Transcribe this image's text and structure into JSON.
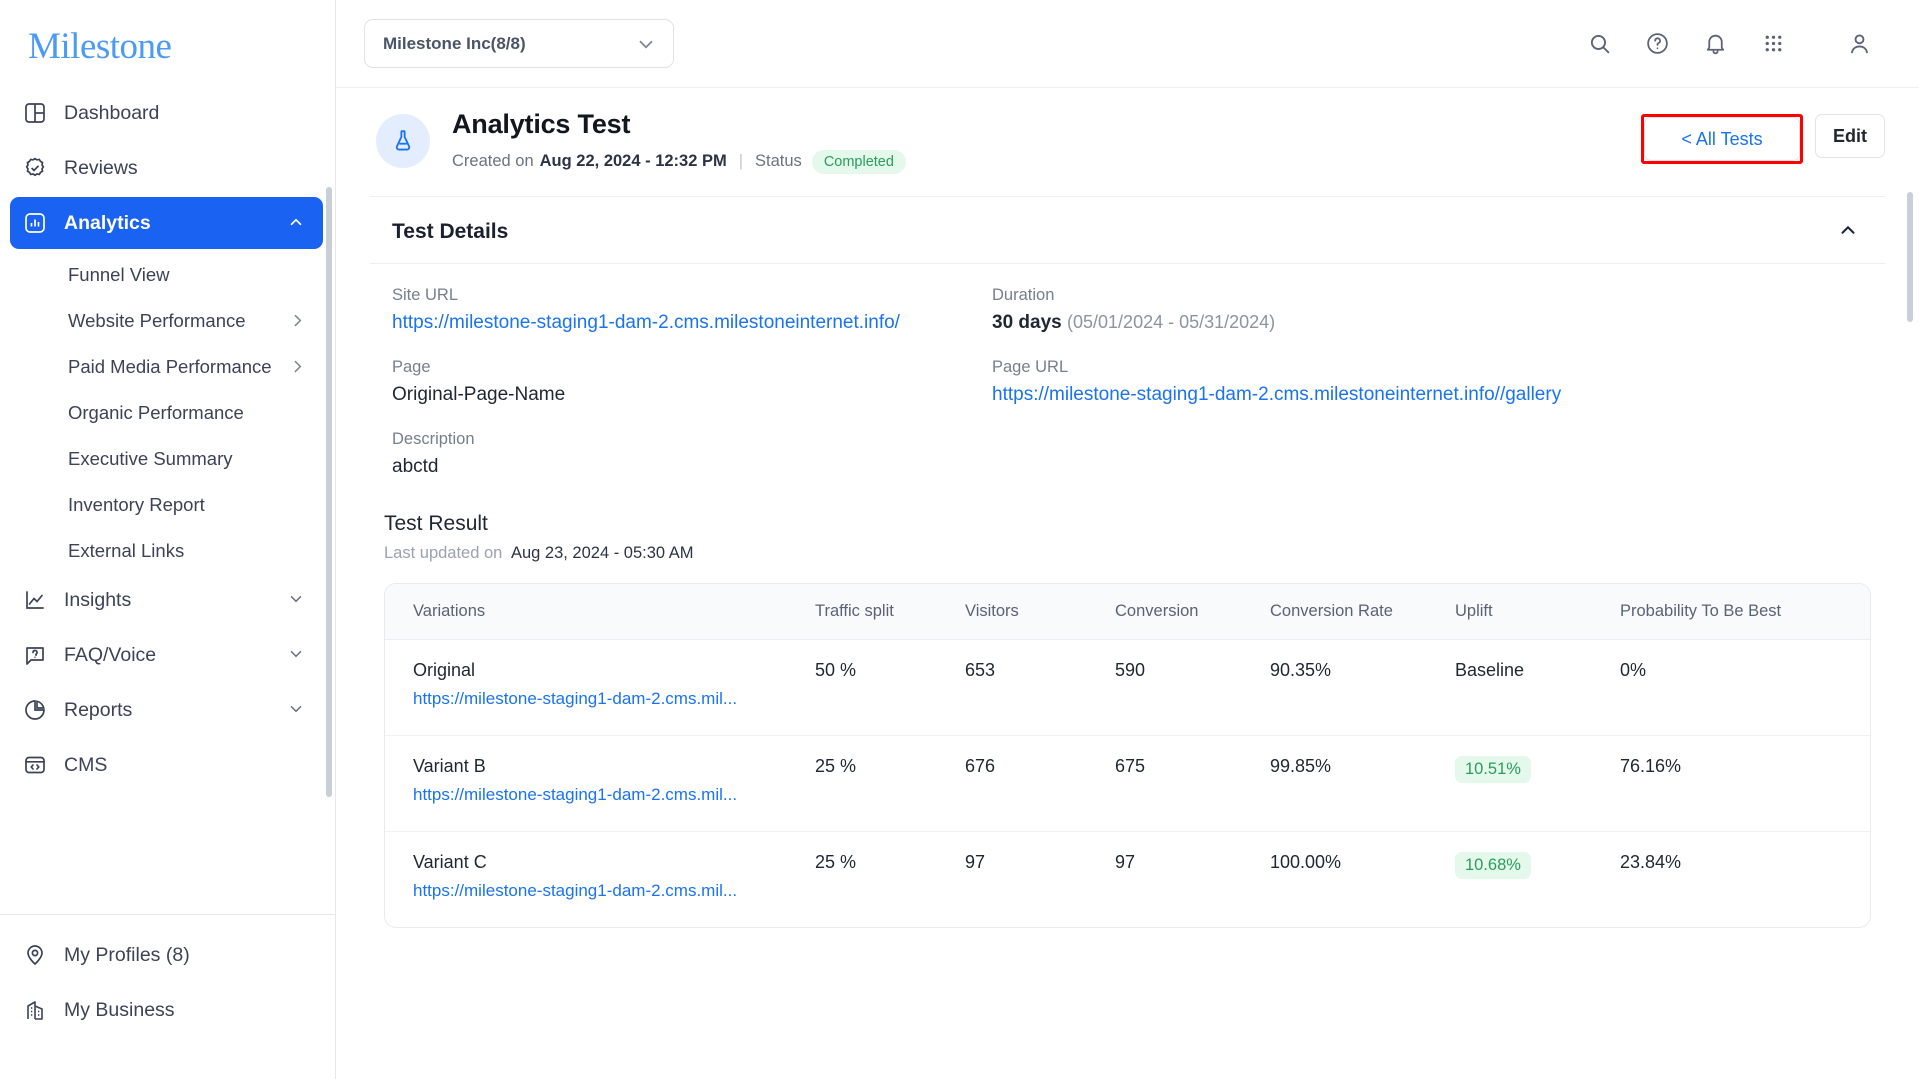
{
  "brand": {
    "logo_text": "Milestone",
    "logo_color": "#4b9bf5",
    "accent": "#1a62f2",
    "link_color": "#1a73ef",
    "success": "#2a9d5c",
    "highlight_border": "#ff0000"
  },
  "sidebar": {
    "items": [
      {
        "label": "Dashboard",
        "icon": "dashboard-icon",
        "type": "item"
      },
      {
        "label": "Reviews",
        "icon": "check-badge-icon",
        "type": "item"
      },
      {
        "label": "Analytics",
        "icon": "bar-chart-icon",
        "type": "item",
        "active": true,
        "chevron": "chevron-up-icon"
      },
      {
        "label": "Funnel View",
        "type": "sub"
      },
      {
        "label": "Website Performance",
        "type": "sub",
        "chevron": "chevron-right-icon"
      },
      {
        "label": "Paid Media Performance",
        "type": "sub",
        "chevron": "chevron-right-icon"
      },
      {
        "label": "Organic Performance",
        "type": "sub"
      },
      {
        "label": "Executive Summary",
        "type": "sub"
      },
      {
        "label": "Inventory Report",
        "type": "sub"
      },
      {
        "label": "External Links",
        "type": "sub"
      },
      {
        "label": "Insights",
        "icon": "trend-line-icon",
        "type": "item",
        "chevron": "chevron-down-icon"
      },
      {
        "label": "FAQ/Voice",
        "icon": "question-bubble-icon",
        "type": "item",
        "chevron": "chevron-down-icon"
      },
      {
        "label": "Reports",
        "icon": "pie-chart-icon",
        "type": "item",
        "chevron": "chevron-down-icon"
      },
      {
        "label": "CMS",
        "icon": "code-window-icon",
        "type": "item"
      }
    ],
    "bottom_items": [
      {
        "label": "My Profiles (8)",
        "icon": "location-pin-icon"
      },
      {
        "label": "My Business",
        "icon": "building-icon"
      }
    ]
  },
  "topbar": {
    "org_select": {
      "value": "Milestone Inc(8/8)",
      "chevron": "chevron-down-icon"
    },
    "icons": [
      {
        "name": "search-icon"
      },
      {
        "name": "help-circle-icon"
      },
      {
        "name": "bell-icon"
      },
      {
        "name": "apps-grid-icon"
      },
      {
        "name": "user-avatar-icon"
      }
    ]
  },
  "page_header": {
    "avatar_icon": "flask-icon",
    "title": "Analytics Test",
    "created_prefix": "Created on",
    "created_on": "Aug 22, 2024 - 12:32 PM",
    "status_label": "Status",
    "status_value": "Completed",
    "all_tests_button": "< All Tests",
    "edit_button": "Edit"
  },
  "test_details": {
    "section_title": "Test Details",
    "toggle_icon": "chevron-up-icon",
    "fields": [
      {
        "label": "Site URL",
        "value": "https://milestone-staging1-dam-2.cms.milestoneinternet.info/",
        "kind": "link"
      },
      {
        "label": "Duration",
        "value": "30 days",
        "suffix": "(05/01/2024 - 05/31/2024)",
        "kind": "bold-suffix"
      },
      {
        "label": "Page",
        "value": "Original-Page-Name",
        "kind": "text"
      },
      {
        "label": "Page URL",
        "value": "https://milestone-staging1-dam-2.cms.milestoneinternet.info//gallery",
        "kind": "link"
      },
      {
        "label": "Description",
        "value": "abctd",
        "kind": "text"
      }
    ]
  },
  "test_result": {
    "title": "Test Result",
    "last_updated_label": "Last updated on",
    "last_updated_value": "Aug 23, 2024 - 05:30 AM",
    "columns": [
      "Variations",
      "Traffic split",
      "Visitors",
      "Conversion",
      "Conversion Rate",
      "Uplift",
      "Probability To Be Best"
    ],
    "rows": [
      {
        "variation": "Original",
        "url": "https://milestone-staging1-dam-2.cms.mil...",
        "traffic_split": "50 %",
        "visitors": "653",
        "conversion": "590",
        "conversion_rate": "90.35%",
        "uplift": "Baseline",
        "uplift_highlight": false,
        "probability": "0%"
      },
      {
        "variation": "Variant B",
        "url": "https://milestone-staging1-dam-2.cms.mil...",
        "traffic_split": "25 %",
        "visitors": "676",
        "conversion": "675",
        "conversion_rate": "99.85%",
        "uplift": "10.51%",
        "uplift_highlight": true,
        "probability": "76.16%"
      },
      {
        "variation": "Variant C",
        "url": "https://milestone-staging1-dam-2.cms.mil...",
        "traffic_split": "25 %",
        "visitors": "97",
        "conversion": "97",
        "conversion_rate": "100.00%",
        "uplift": "10.68%",
        "uplift_highlight": true,
        "probability": "23.84%"
      }
    ]
  }
}
